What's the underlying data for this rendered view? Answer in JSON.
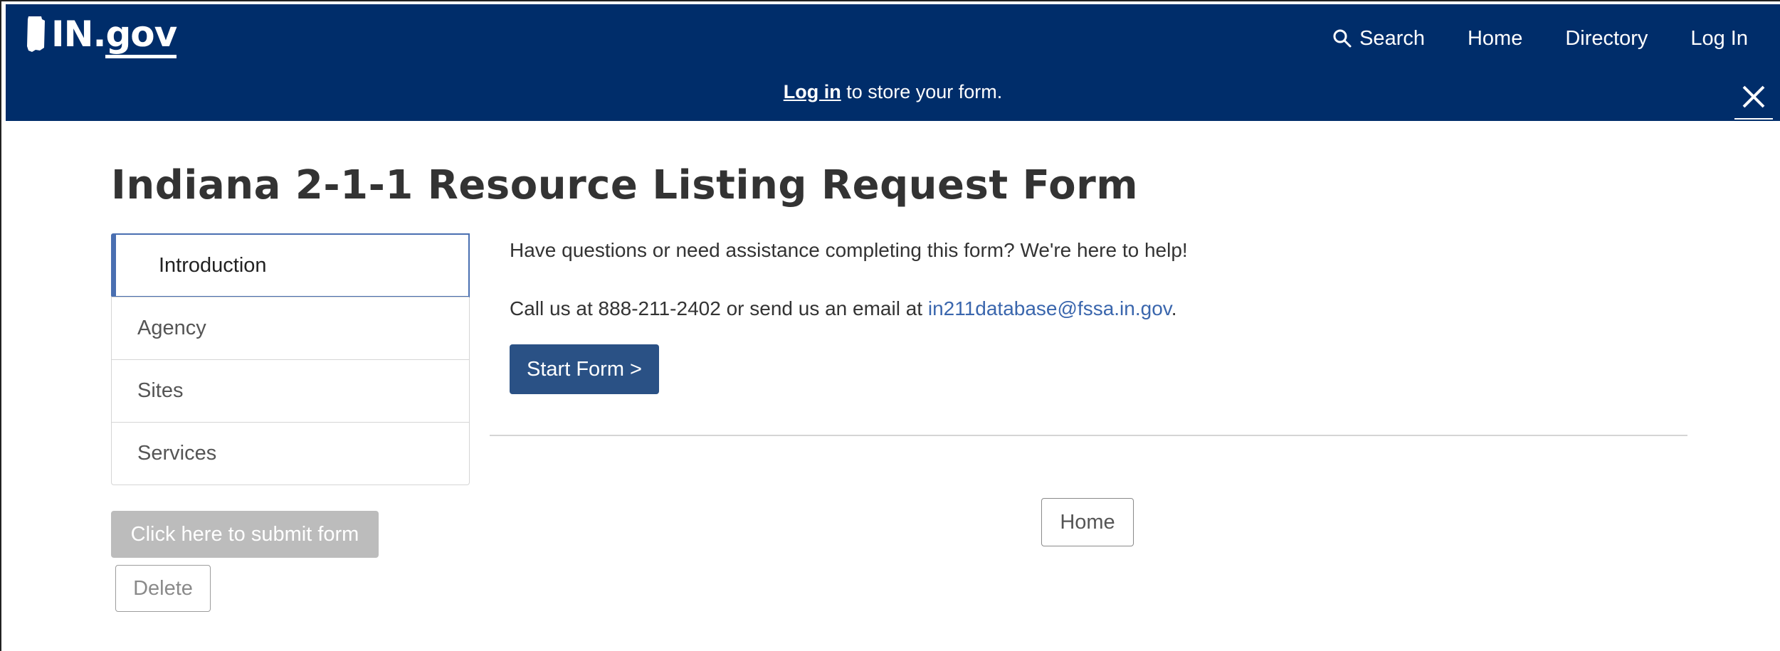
{
  "header": {
    "logo_text_in": "IN.",
    "logo_text_gov": "gov",
    "nav": {
      "search_label": "Search",
      "home_label": "Home",
      "directory_label": "Directory",
      "login_label": "Log In"
    },
    "notice": {
      "link_text": "Log in",
      "rest_text": " to store your form."
    },
    "colors": {
      "bar": "#002d6a",
      "text": "#ffffff"
    }
  },
  "page": {
    "title": "Indiana 2-1-1 Resource Listing Request Form"
  },
  "sidebar": {
    "items": [
      {
        "label": "Introduction",
        "active": true
      },
      {
        "label": "Agency",
        "active": false
      },
      {
        "label": "Sites",
        "active": false
      },
      {
        "label": "Services",
        "active": false
      }
    ],
    "submit_label": "Click here to submit form",
    "delete_label": "Delete"
  },
  "main": {
    "intro": "Have questions or need assistance completing this form? We're here to help!",
    "contact_prefix": "Call us at 888-211-2402 or send us an email at ",
    "contact_email": "in211database@fssa.in.gov",
    "contact_suffix": ".",
    "start_label": "Start Form >",
    "home_label": "Home"
  },
  "icons": {
    "search": "search-icon",
    "close": "close-icon",
    "logo": "indiana-state-shape-icon"
  }
}
